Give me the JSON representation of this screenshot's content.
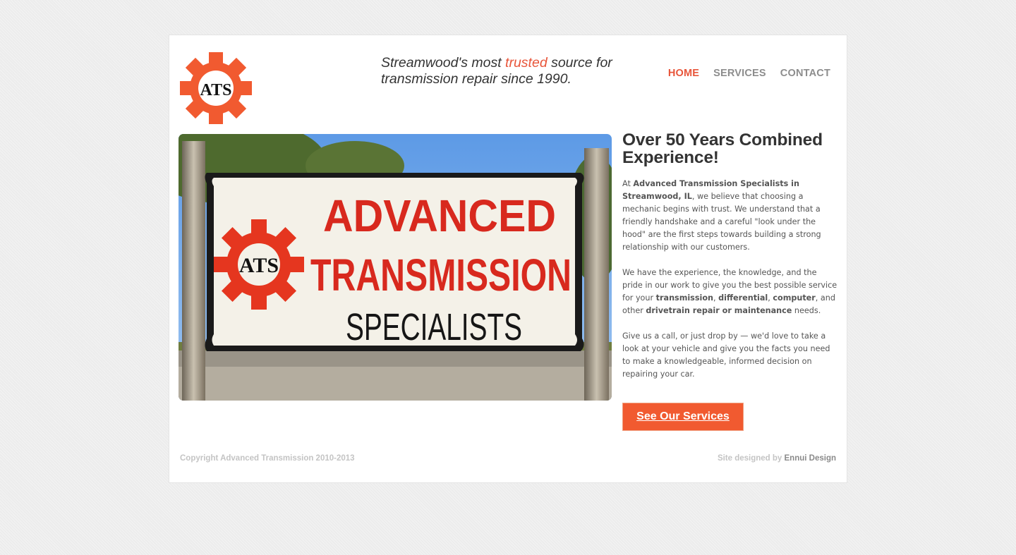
{
  "header": {
    "logo_text": "ATS",
    "tagline_part1": "Streamwood's most ",
    "tagline_accent": "trusted",
    "tagline_part2": " source for transmission repair since 1990."
  },
  "nav": {
    "items": [
      {
        "label": "HOME",
        "active": true
      },
      {
        "label": "SERVICES",
        "active": false
      },
      {
        "label": "CONTACT",
        "active": false
      }
    ]
  },
  "hero": {
    "sign_line1": "ADVANCED",
    "sign_line2": "TRANSMISSION",
    "sign_line3": "SPECIALISTS",
    "sign_logo": "ATS"
  },
  "content": {
    "heading": "Over 50 Years Combined Experience!",
    "p1_a": "At ",
    "p1_b": "Advanced Transmission Specialists in Streamwood, IL",
    "p1_c": ", we believe that choosing a mechanic begins with trust.  We understand that a friendly handshake and a careful \"look under the hood\" are the first steps towards building a strong relationship with our customers.",
    "p2_a": "We have the experience, the knowledge, and the pride in our work to give you the best possible service for your ",
    "p2_b": "transmission",
    "p2_c": ", ",
    "p2_d": "differential",
    "p2_e": ", ",
    "p2_f": "computer",
    "p2_g": ", and other ",
    "p2_h": "drivetrain repair or maintenance",
    "p2_i": " needs.",
    "p3": "Give us a call, or just drop by — we'd love to take a look at your vehicle and give you the facts you need to make a knowledgeable, informed decision on repairing your car.",
    "cta_label": "See Our Services"
  },
  "footer": {
    "copyright": "Copyright Advanced Transmission 2010-2013",
    "designed_by": "Site designed by ",
    "designer": "Ennui Design"
  },
  "colors": {
    "accent": "#e8553a",
    "button": "#f15a30",
    "nav_inactive": "#8d8d8d",
    "text": "#333333"
  }
}
